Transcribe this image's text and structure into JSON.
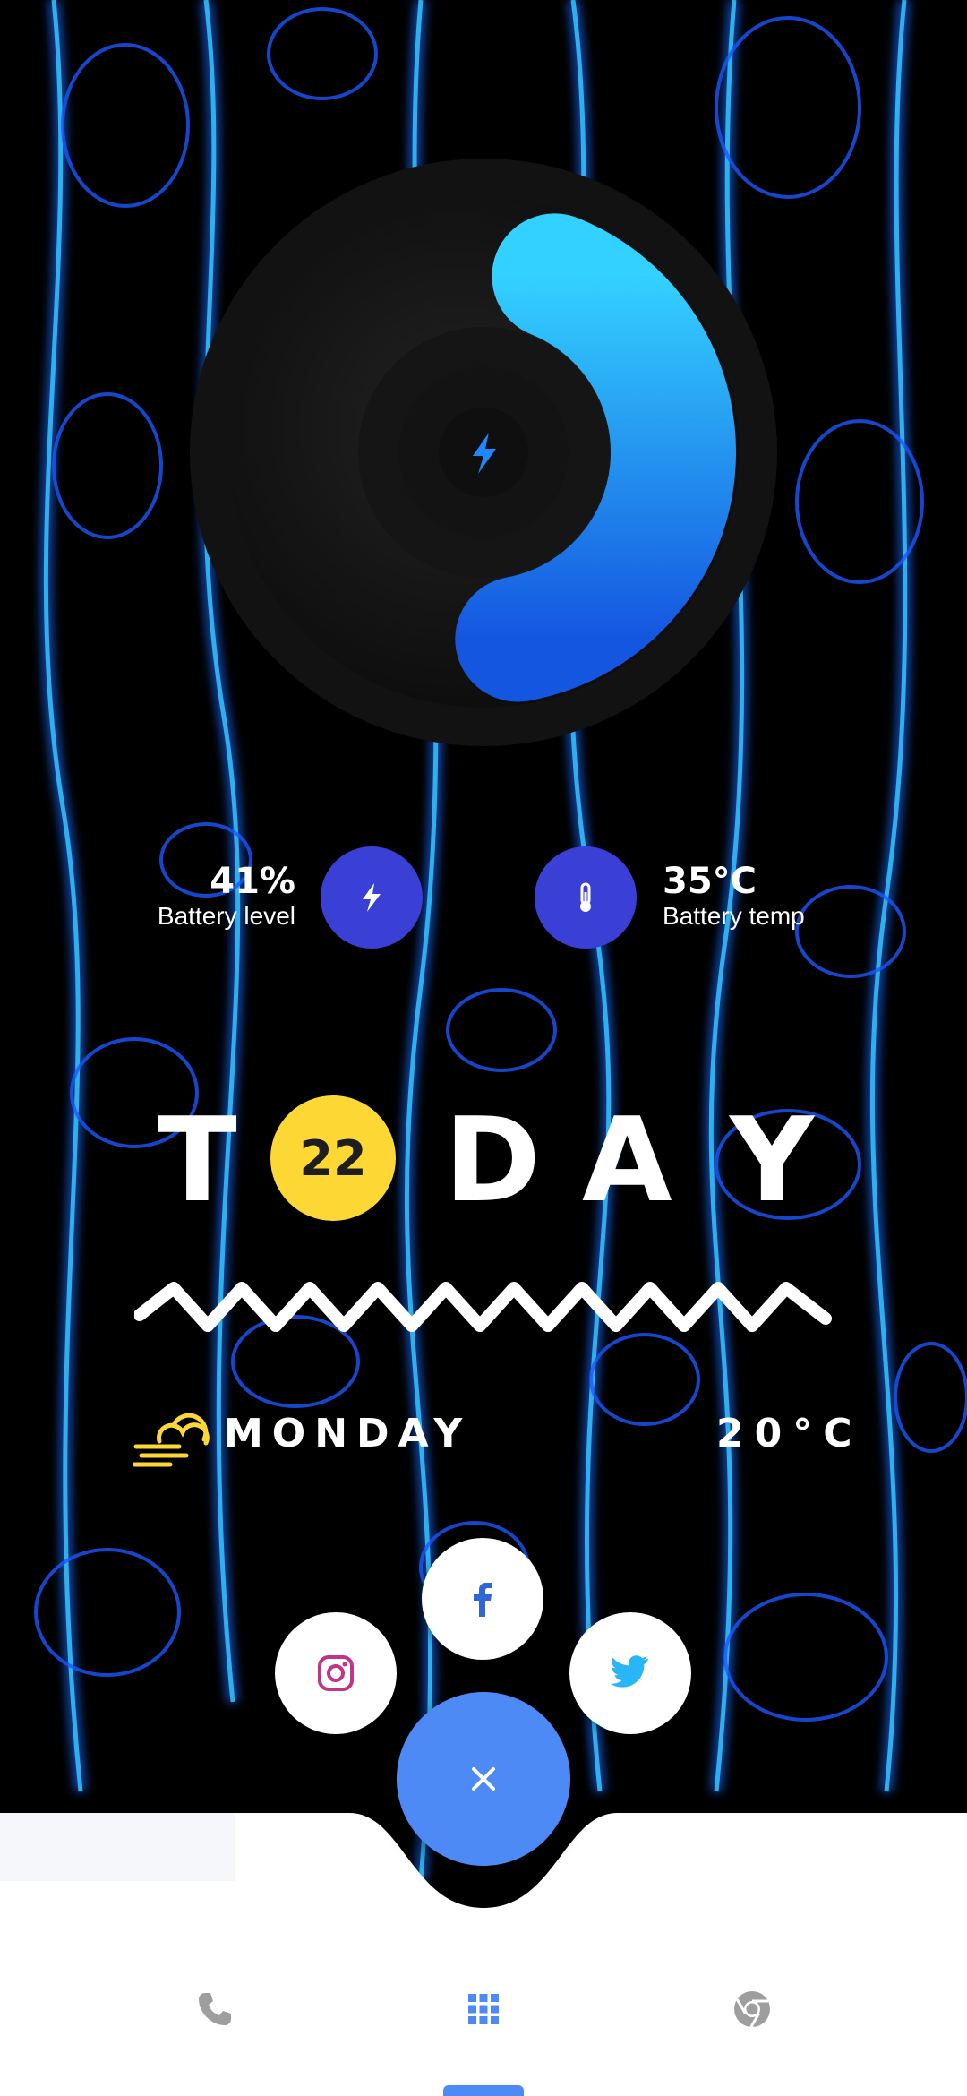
{
  "battery_widget": {
    "level_fraction": 0.41,
    "accent": "#29b6f6"
  },
  "stats": {
    "battery_level": {
      "value": "41%",
      "label": "Battery level",
      "icon": "lightning-icon"
    },
    "battery_temp": {
      "value": "35°C",
      "label": "Battery temp",
      "icon": "thermometer-icon"
    }
  },
  "today": {
    "letters": [
      "T",
      "D",
      "A",
      "Y"
    ],
    "date": "22"
  },
  "weather": {
    "day": "MONDAY",
    "temperature": "20°C",
    "icon": "cloud-sun-icon"
  },
  "social": {
    "facebook": "facebook-icon",
    "instagram": "instagram-icon",
    "twitter": "twitter-icon",
    "close": "close-icon"
  },
  "dock": {
    "icons": [
      "phone-icon",
      "app-drawer-icon",
      "chrome-icon"
    ]
  },
  "colors": {
    "accent_blue": "#4d8af5",
    "stat_circle": "#3a3fd6",
    "date_circle": "#fdd835"
  }
}
